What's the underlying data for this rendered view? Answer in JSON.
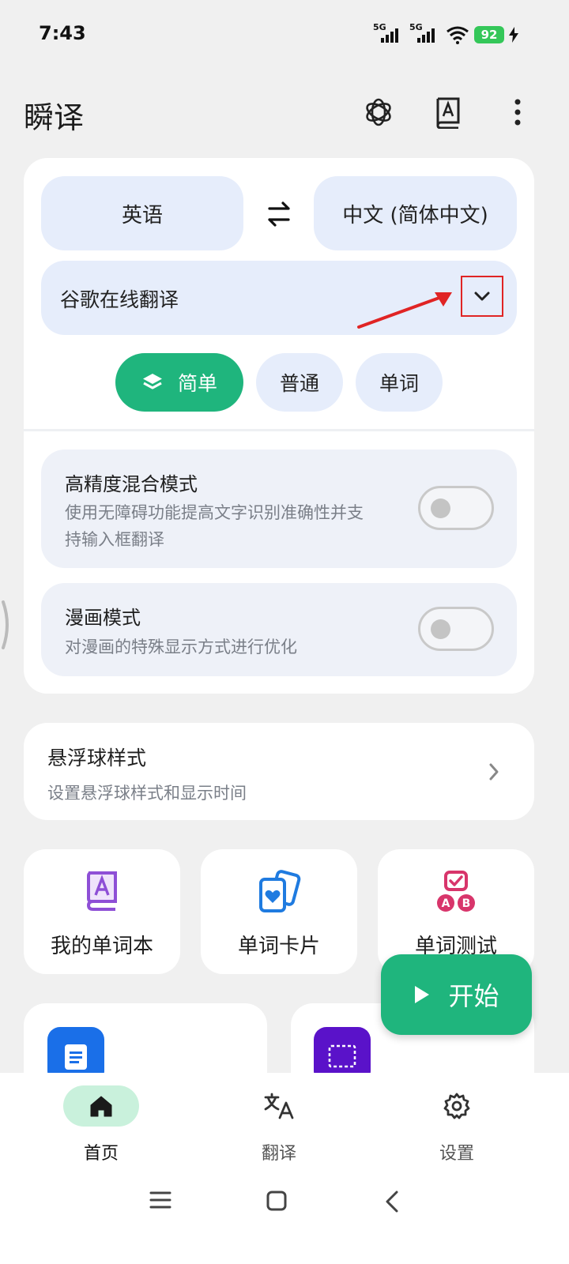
{
  "status_bar": {
    "time": "7:43",
    "network_1": "5G",
    "network_2": "5G",
    "battery": "92"
  },
  "header": {
    "title": "瞬译",
    "icons": [
      "openai-icon",
      "dictionary-icon",
      "more-vert-icon"
    ]
  },
  "translation": {
    "source_lang": "英语",
    "target_lang": "中文 (简体中文)",
    "engine": "谷歌在线翻译",
    "modes": [
      {
        "label": "简单",
        "active": true
      },
      {
        "label": "普通",
        "active": false
      },
      {
        "label": "单词",
        "active": false
      }
    ]
  },
  "options": [
    {
      "title": "高精度混合模式",
      "desc_line1": "使用无障碍功能提高文字识别准确性并支",
      "desc_line2": "持输入框翻译",
      "enabled": false
    },
    {
      "title": "漫画模式",
      "desc": "对漫画的特殊显示方式进行优化",
      "enabled": false
    }
  ],
  "float_ball": {
    "title": "悬浮球样式",
    "desc": "设置悬浮球样式和显示时间"
  },
  "features": [
    {
      "label": "我的单词本",
      "icon": "wordbook-icon"
    },
    {
      "label": "单词卡片",
      "icon": "word-cards-icon"
    },
    {
      "label": "单词测试",
      "icon": "word-test-icon"
    }
  ],
  "start_button": {
    "label": "开始"
  },
  "bottom_nav": [
    {
      "label": "首页",
      "icon": "home-icon",
      "active": true
    },
    {
      "label": "翻译",
      "icon": "translate-icon",
      "active": false
    },
    {
      "label": "设置",
      "icon": "gear-icon",
      "active": false
    }
  ],
  "colors": {
    "accent_green": "#1fb57d",
    "pill_blue": "#e6edfb",
    "highlight_red": "#e02424"
  }
}
